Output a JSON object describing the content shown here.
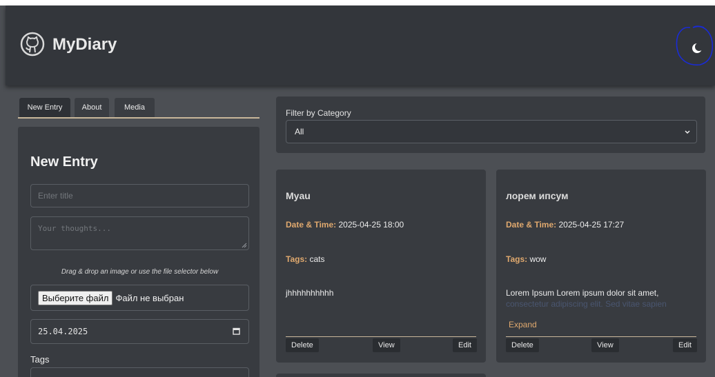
{
  "header": {
    "app_title": "MyDiary",
    "theme_icon": "moon-icon",
    "logo_icon": "github-icon"
  },
  "tabs": [
    {
      "label": "New Entry",
      "active": true
    },
    {
      "label": "About",
      "active": false
    },
    {
      "label": "Media",
      "active": false
    }
  ],
  "form": {
    "title": "New Entry",
    "title_placeholder": "Enter title",
    "thoughts_placeholder": "Your thoughts...",
    "drop_hint": "Drag & drop an image or use the file selector below",
    "file_button": "Выберите файл",
    "file_status": "Файл не выбран",
    "date_value": "25.04.2025",
    "tags_label": "Tags"
  },
  "filter": {
    "label": "Filter by Category",
    "selected": "All"
  },
  "entries": [
    {
      "title": "Myau",
      "date_label": "Date & Time:",
      "date": "2025-04-25 18:00",
      "tags_label": "Tags:",
      "tags": "cats",
      "body": "jhhhhhhhhhh",
      "delete": "Delete",
      "view": "View",
      "edit": "Edit"
    },
    {
      "title": "лорем ипсум",
      "date_label": "Date & Time:",
      "date": "2025-04-25 17:27",
      "tags_label": "Tags:",
      "tags": "wow",
      "body": "Lorem Ipsum Lorem ipsum dolor sit amet,",
      "body_faded": "consectetur adipiscing elit. Sed vitae sapien",
      "expand": "Expand",
      "delete": "Delete",
      "view": "View",
      "edit": "Edit"
    }
  ],
  "colors": {
    "accent": "#e0a96e",
    "header_bg": "#33363b",
    "page_bg": "#4c4f54",
    "panel_bg": "#383b40",
    "annotation": "#1a2bd6"
  }
}
